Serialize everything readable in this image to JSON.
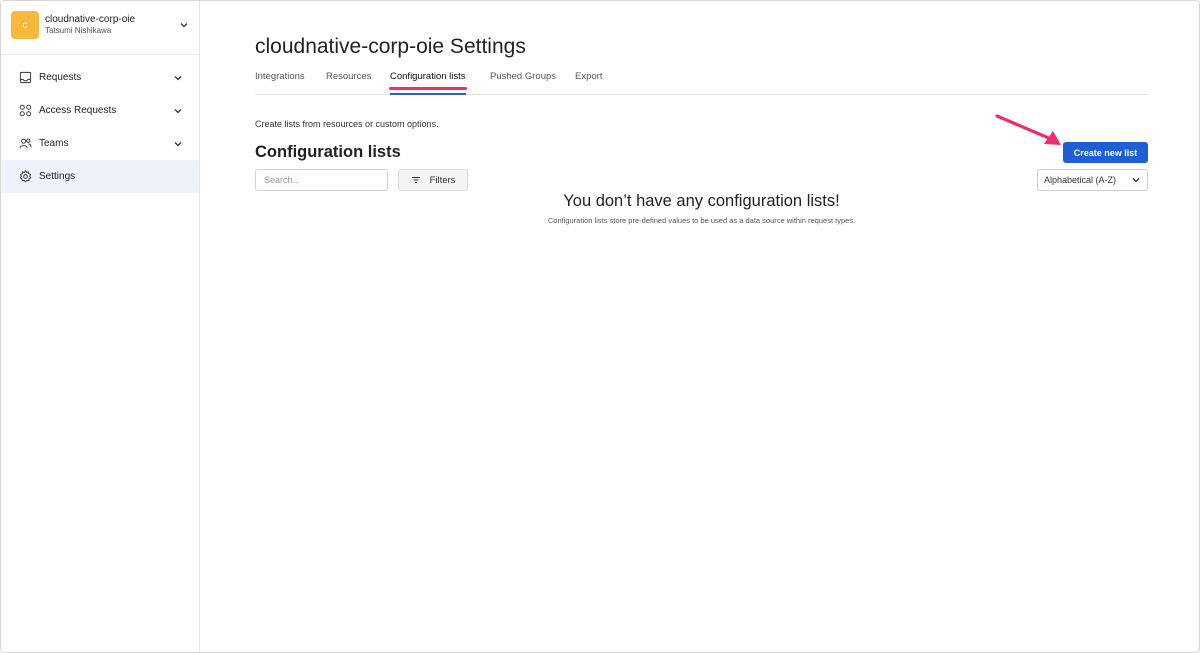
{
  "org": {
    "avatar_letter": "c",
    "name": "cloudnative-corp-oie",
    "user": "Tatsumi Nishikawa",
    "avatar_color": "#f8b93a"
  },
  "sidebar": {
    "items": [
      {
        "label": "Requests",
        "icon": "inbox-icon",
        "has_chevron": true
      },
      {
        "label": "Access Requests",
        "icon": "grid-icon",
        "has_chevron": true
      },
      {
        "label": "Teams",
        "icon": "people-icon",
        "has_chevron": true
      },
      {
        "label": "Settings",
        "icon": "gear-icon",
        "active": true
      }
    ]
  },
  "page": {
    "title": "cloudnative-corp-oie Settings",
    "tabs": [
      {
        "label": "Integrations"
      },
      {
        "label": "Resources"
      },
      {
        "label": "Configuration lists",
        "active": true
      },
      {
        "label": "Pushed Groups"
      },
      {
        "label": "Export"
      }
    ],
    "description": "Create lists from resources or custom options.",
    "section_title": "Configuration lists",
    "search_placeholder": "Search...",
    "filters_label": "Filters",
    "create_button_label": "Create new list",
    "sort_value": "Alphabetical (A-Z)",
    "empty_title": "You don’t have any configuration lists!",
    "empty_subtitle": "Configuration lists store pre-defined values to be used as a data source within request types."
  },
  "colors": {
    "primary": "#1f5fd6",
    "highlight": "#ee2c6f",
    "active_nav_bg": "#eef2fb"
  }
}
